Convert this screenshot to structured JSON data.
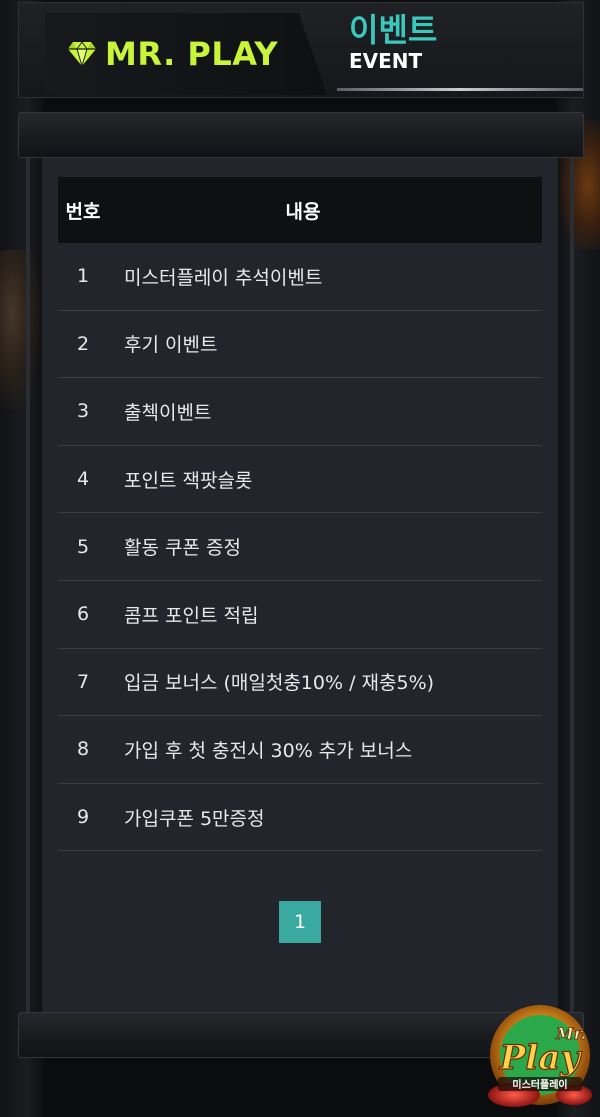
{
  "header": {
    "brand": "MR. PLAY",
    "title_ko": "이벤트",
    "title_en": "EVENT"
  },
  "table": {
    "col_num": "번호",
    "col_content": "내용",
    "rows": [
      {
        "num": "1",
        "text": "미스터플레이 추석이벤트"
      },
      {
        "num": "2",
        "text": "후기 이벤트"
      },
      {
        "num": "3",
        "text": "출첵이벤트"
      },
      {
        "num": "4",
        "text": "포인트 잭팟슬롯"
      },
      {
        "num": "5",
        "text": "활동 쿠폰 증정"
      },
      {
        "num": "6",
        "text": "콤프 포인트 적립"
      },
      {
        "num": "7",
        "text": "입금 보너스 (매일첫충10% / 재충5%)"
      },
      {
        "num": "8",
        "text": "가입 후 첫 충전시 30% 추가 보너스"
      },
      {
        "num": "9",
        "text": "가입쿠폰 5만증정"
      }
    ]
  },
  "pagination": {
    "current": "1"
  },
  "corner_badge": {
    "line1": "Mr.",
    "line2": "Play",
    "line3": "미스터플레이"
  },
  "colors": {
    "brand_green": "#c8f53a",
    "accent_teal": "#3cc7bd",
    "pager_teal": "#3aa9a0",
    "panel_bg": "#22252b"
  },
  "icons": {
    "brand": "diamond-icon"
  }
}
